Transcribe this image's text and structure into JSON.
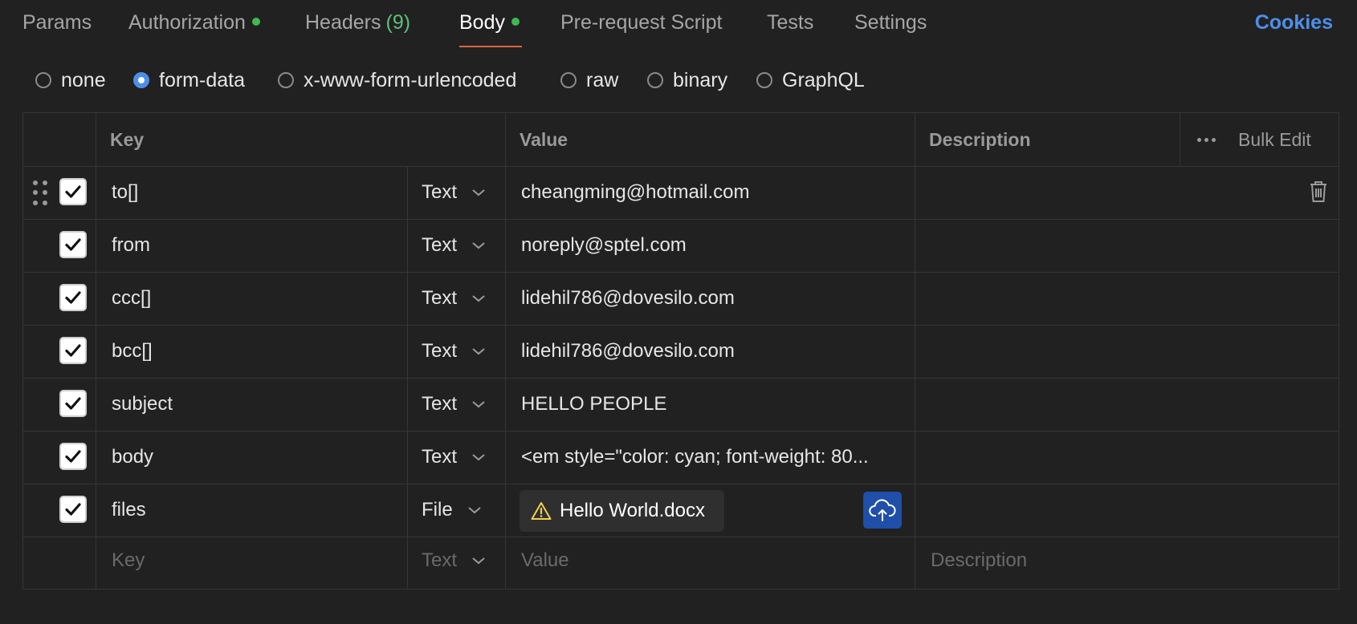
{
  "tabs": {
    "params": "Params",
    "authorization": "Authorization",
    "headers": "Headers",
    "headers_count": "(9)",
    "body": "Body",
    "prerequest": "Pre-request Script",
    "tests": "Tests",
    "settings": "Settings",
    "cookies": "Cookies"
  },
  "body_types": {
    "none": "none",
    "form_data": "form-data",
    "urlencoded": "x-www-form-urlencoded",
    "raw": "raw",
    "binary": "binary",
    "graphql": "GraphQL",
    "selected": "form-data"
  },
  "table": {
    "headers": {
      "key": "Key",
      "value": "Value",
      "description": "Description",
      "bulk_edit": "Bulk Edit"
    },
    "rows": [
      {
        "key": "to[]",
        "type": "Text",
        "value": "cheangming@hotmail.com",
        "checked": true
      },
      {
        "key": "from",
        "type": "Text",
        "value": "noreply@sptel.com",
        "checked": true
      },
      {
        "key": "ccc[]",
        "type": "Text",
        "value": "lidehil786@dovesilo.com",
        "checked": true
      },
      {
        "key": "bcc[]",
        "type": "Text",
        "value": "lidehil786@dovesilo.com",
        "checked": true
      },
      {
        "key": "subject",
        "type": "Text",
        "value": "HELLO PEOPLE",
        "checked": true
      },
      {
        "key": "body",
        "type": "Text",
        "value": "<em style=\"color: cyan; font-weight: 80...",
        "checked": true
      },
      {
        "key": "files",
        "type": "File",
        "value": "Hello World.docx",
        "checked": true
      }
    ],
    "new_row": {
      "key_placeholder": "Key",
      "type": "Text",
      "value_placeholder": "Value",
      "description_placeholder": "Description"
    }
  },
  "colors": {
    "background": "#212121",
    "accent_blue": "#4d8fe8",
    "active_underline": "#e0643f",
    "status_dot": "#3fb950",
    "warning": "#f2d24b",
    "upload_button": "#1f4fa8"
  }
}
